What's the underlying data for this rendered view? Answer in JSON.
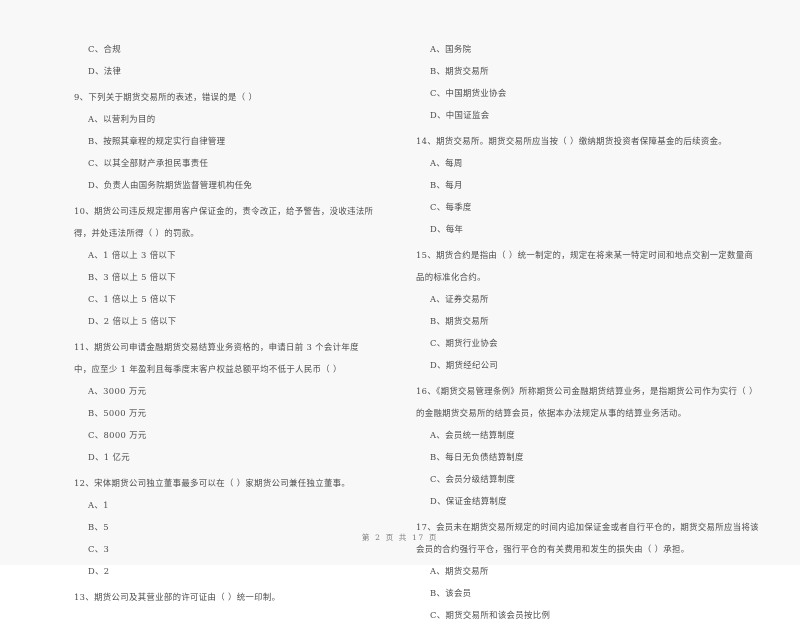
{
  "document": {
    "page_label": "第 2 页 共 17 页",
    "page_number": "2",
    "total_pages": "17",
    "text_color": "#333132",
    "background_color": "#fdfdfd"
  },
  "left_column": {
    "items": [
      {
        "kind": "option",
        "text": "C、合规"
      },
      {
        "kind": "option",
        "text": "D、法律"
      },
      {
        "kind": "stem",
        "text": "9、下列关于期货交易所的表述，错误的是（        ）"
      },
      {
        "kind": "option",
        "text": "A、以营利为目的"
      },
      {
        "kind": "option",
        "text": "B、按照其章程的规定实行自律管理"
      },
      {
        "kind": "option",
        "text": "C、以其全部财产承担民事责任"
      },
      {
        "kind": "option",
        "text": "D、负责人由国务院期货监督管理机构任免"
      },
      {
        "kind": "stem",
        "text": "10、期货公司违反规定挪用客户保证金的，责令改正，给予警告，没收违法所得，并处违法所得（        ）的罚款。"
      },
      {
        "kind": "option",
        "text": "A、1 倍以上 3 倍以下"
      },
      {
        "kind": "option",
        "text": "B、3 倍以上 5 倍以下"
      },
      {
        "kind": "option",
        "text": "C、1 倍以上 5 倍以下"
      },
      {
        "kind": "option",
        "text": "D、2 倍以上 5 倍以下"
      },
      {
        "kind": "stem",
        "text": "11、期货公司申请金融期货交易结算业务资格的，申请日前 3 个会计年度中，应至少 1 年盈利且每季度末客户权益总额平均不低于人民币（        ）"
      },
      {
        "kind": "option",
        "text": "A、3000 万元"
      },
      {
        "kind": "option",
        "text": "B、5000 万元"
      },
      {
        "kind": "option",
        "text": "C、8000 万元"
      },
      {
        "kind": "option",
        "text": "D、1 亿元"
      },
      {
        "kind": "stem",
        "text": "12、宋体期货公司独立董事最多可以在（        ）家期货公司兼任独立董事。"
      },
      {
        "kind": "option",
        "text": "A、1"
      },
      {
        "kind": "option",
        "text": "B、5"
      },
      {
        "kind": "option",
        "text": "C、3"
      },
      {
        "kind": "option",
        "text": "D、2"
      },
      {
        "kind": "stem",
        "text": "13、期货公司及其营业部的许可证由（        ）统一印制。"
      }
    ]
  },
  "right_column": {
    "items": [
      {
        "kind": "option",
        "text": "A、国务院"
      },
      {
        "kind": "option",
        "text": "B、期货交易所"
      },
      {
        "kind": "option",
        "text": "C、中国期货业协会"
      },
      {
        "kind": "option",
        "text": "D、中国证监会"
      },
      {
        "kind": "stem",
        "text": "14、期货交易所。期货交易所应当按（        ）缴纳期货投资者保障基金的后续资金。"
      },
      {
        "kind": "option",
        "text": "A、每周"
      },
      {
        "kind": "option",
        "text": "B、每月"
      },
      {
        "kind": "option",
        "text": "C、每季度"
      },
      {
        "kind": "option",
        "text": "D、每年"
      },
      {
        "kind": "stem",
        "text": "15、期货合约是指由（        ）统一制定的，规定在将来某一特定时间和地点交割一定数量商品的标准化合约。"
      },
      {
        "kind": "option",
        "text": "A、证券交易所"
      },
      {
        "kind": "option",
        "text": "B、期货交易所"
      },
      {
        "kind": "option",
        "text": "C、期货行业协会"
      },
      {
        "kind": "option",
        "text": "D、期货经纪公司"
      },
      {
        "kind": "stem",
        "text": "16、《期货交易管理条例》所称期货公司金融期货结算业务，是指期货公司作为实行（        ）的金融期货交易所的结算会员，依据本办法规定从事的结算业务活动。"
      },
      {
        "kind": "option",
        "text": "A、会员统一结算制度"
      },
      {
        "kind": "option",
        "text": "B、每日无负债结算制度"
      },
      {
        "kind": "option",
        "text": "C、会员分级结算制度"
      },
      {
        "kind": "option",
        "text": "D、保证金结算制度"
      },
      {
        "kind": "stem",
        "text": "17、会员未在期货交易所规定的时间内追加保证金或者自行平仓的，期货交易所应当将该会员的合约强行平仓，强行平仓的有关费用和发生的损失由（        ）承担。"
      },
      {
        "kind": "option",
        "text": "A、期货交易所"
      },
      {
        "kind": "option",
        "text": "B、该会员"
      },
      {
        "kind": "option",
        "text": "C、期货交易所和该会员按比例"
      }
    ]
  }
}
